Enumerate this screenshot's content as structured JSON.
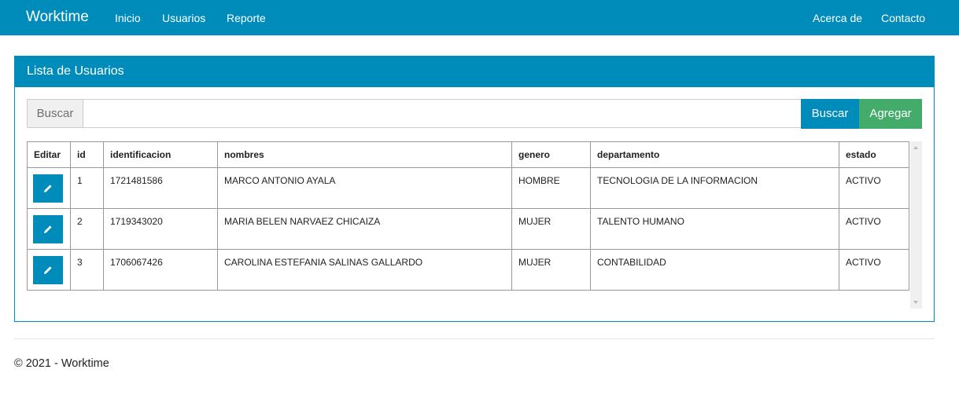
{
  "navbar": {
    "brand": "Worktime",
    "links": [
      "Inicio",
      "Usuarios",
      "Reporte"
    ],
    "right_links": [
      "Acerca de",
      "Contacto"
    ]
  },
  "panel": {
    "title": "Lista de Usuarios",
    "search": {
      "addon_label": "Buscar",
      "value": "",
      "button_label": "Buscar"
    },
    "add_button_label": "Agregar"
  },
  "table": {
    "columns": [
      "Editar",
      "id",
      "identificacion",
      "nombres",
      "genero",
      "departamento",
      "estado"
    ],
    "rows": [
      {
        "id": "1",
        "identificacion": "1721481586",
        "nombres": "MARCO ANTONIO AYALA",
        "genero": "HOMBRE",
        "departamento": "TECNOLOGIA DE LA INFORMACION",
        "estado": "ACTIVO"
      },
      {
        "id": "2",
        "identificacion": "1719343020",
        "nombres": "MARIA BELEN NARVAEZ CHICAIZA",
        "genero": "MUJER",
        "departamento": "TALENTO HUMANO",
        "estado": "ACTIVO"
      },
      {
        "id": "3",
        "identificacion": "1706067426",
        "nombres": "CAROLINA ESTEFANIA SALINAS GALLARDO",
        "genero": "MUJER",
        "departamento": "CONTABILIDAD",
        "estado": "ACTIVO"
      }
    ]
  },
  "footer": {
    "text": "© 2021 - Worktime"
  },
  "icons": {
    "edit": "pencil-icon"
  },
  "colors": {
    "primary": "#008cba",
    "success": "#43ac6a"
  }
}
